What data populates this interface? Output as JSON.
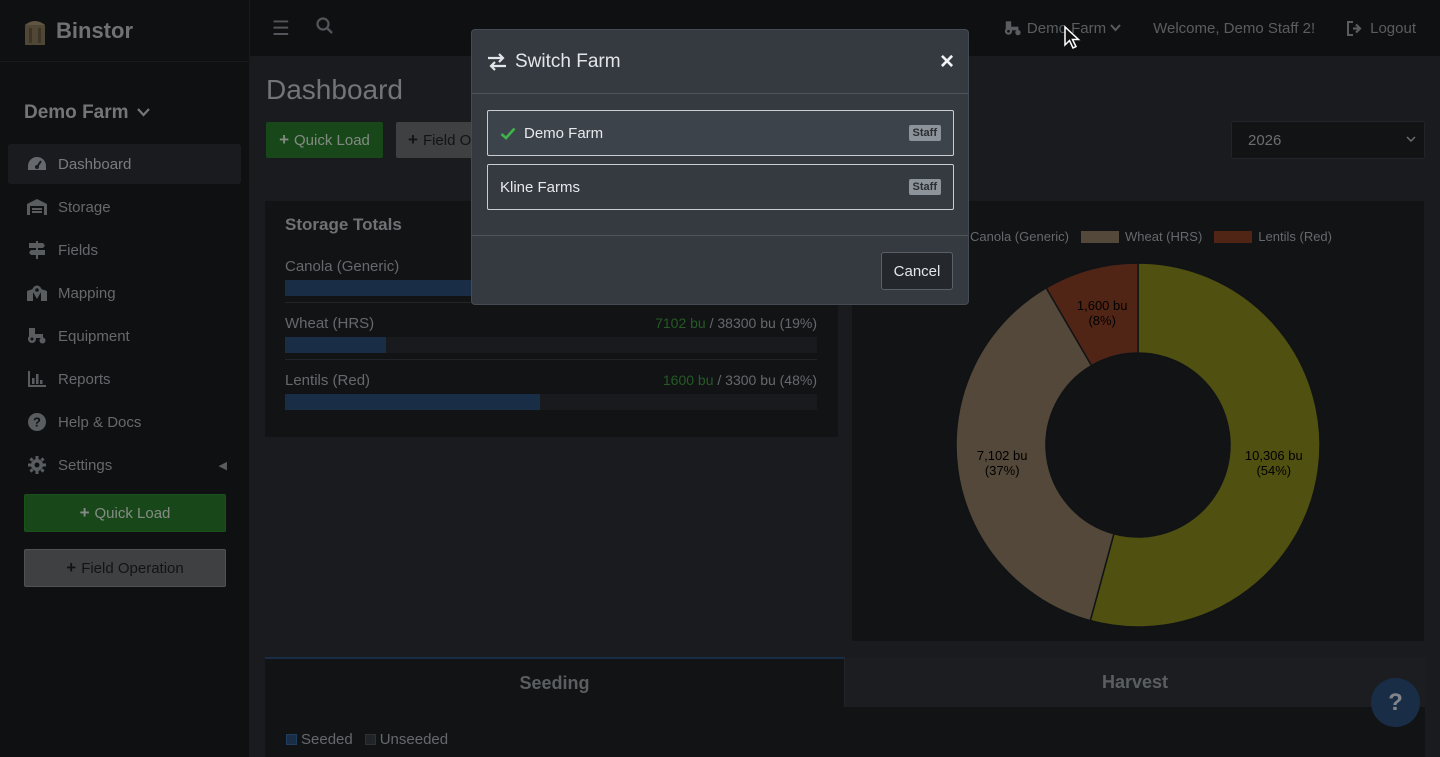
{
  "app": {
    "brand": "Binstor"
  },
  "sidebar": {
    "farm_name": "Demo Farm",
    "items": [
      {
        "label": "Dashboard",
        "icon": "gauge-icon"
      },
      {
        "label": "Storage",
        "icon": "warehouse-icon"
      },
      {
        "label": "Fields",
        "icon": "signpost-icon"
      },
      {
        "label": "Mapping",
        "icon": "map-marked-icon"
      },
      {
        "label": "Equipment",
        "icon": "tractor-icon"
      },
      {
        "label": "Reports",
        "icon": "chart-bar-icon"
      },
      {
        "label": "Help & Docs",
        "icon": "question-circle-icon"
      },
      {
        "label": "Settings",
        "icon": "gear-icon"
      }
    ],
    "quick_load": "Quick Load",
    "field_operation": "Field Operation"
  },
  "topbar": {
    "farm_switch": "Demo Farm",
    "welcome": "Welcome, Demo Staff 2!",
    "logout": "Logout"
  },
  "main": {
    "title": "Dashboard",
    "quick_load": "Quick Load",
    "field_op_partial": "Field O",
    "year": "2026",
    "storage": {
      "title": "Storage Totals",
      "rows": [
        {
          "name": "Canola (Generic)",
          "stored": "",
          "capacity": "",
          "fraction": 0.35
        },
        {
          "name": "Wheat (HRS)",
          "stored": "7102 bu",
          "capacity": " / 38300 bu (19%)",
          "fraction": 0.19
        },
        {
          "name": "Lentils (Red)",
          "stored": "1600 bu",
          "capacity": " / 3300 bu (48%)",
          "fraction": 0.48
        }
      ]
    },
    "tabs": {
      "seeding": "Seeding",
      "harvest": "Harvest"
    },
    "seed_legend": {
      "seeded": "Seeded",
      "unseeded": "Unseeded"
    },
    "help": "?"
  },
  "chart_data": {
    "type": "pie",
    "donut": true,
    "legend_position": "top",
    "categories": [
      "Canola (Generic)",
      "Wheat (HRS)",
      "Lentils (Red)"
    ],
    "values": [
      10306,
      7102,
      1600
    ],
    "labels": [
      [
        "10,306 bu",
        "(54%)"
      ],
      [
        "7,102 bu",
        "(37%)"
      ],
      [
        "1,600 bu",
        "(8%)"
      ]
    ],
    "colors": [
      "#8b8b1e",
      "#8f7c62",
      "#8c4027"
    ]
  },
  "modal": {
    "title": "Switch Farm",
    "close": "×",
    "farms": [
      {
        "name": "Demo Farm",
        "role": "Staff",
        "selected": true
      },
      {
        "name": "Kline Farms",
        "role": "Staff",
        "selected": false
      }
    ],
    "cancel": "Cancel"
  }
}
